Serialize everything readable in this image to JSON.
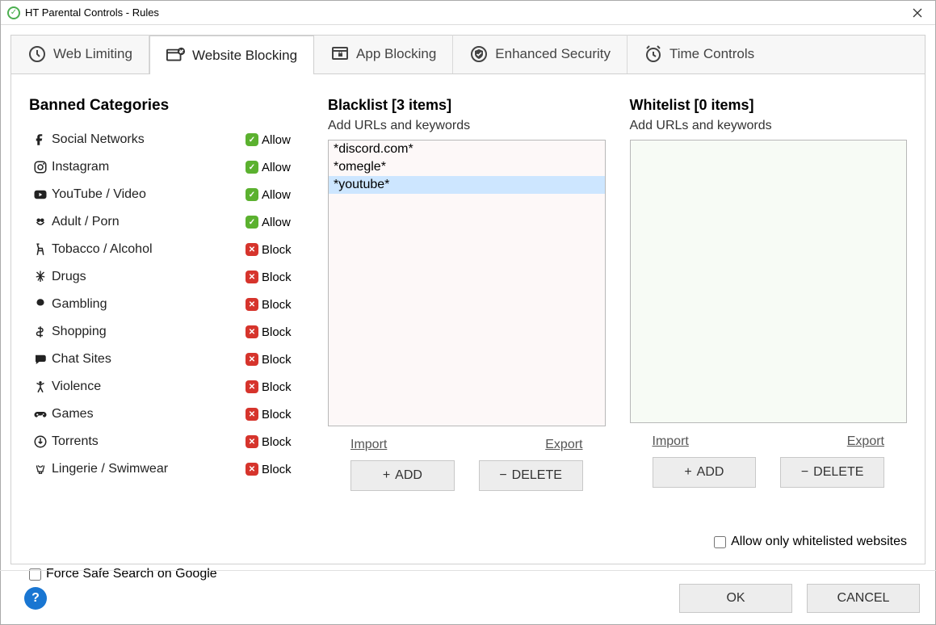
{
  "window": {
    "title": "HT Parental Controls - Rules"
  },
  "tabs": {
    "web_limiting": "Web Limiting",
    "website_blocking": "Website Blocking",
    "app_blocking": "App Blocking",
    "enhanced_security": "Enhanced Security",
    "time_controls": "Time Controls"
  },
  "categories": {
    "title": "Banned Categories",
    "allow_text": "Allow",
    "block_text": "Block",
    "items": [
      {
        "label": "Social Networks",
        "status": "allow"
      },
      {
        "label": "Instagram",
        "status": "allow"
      },
      {
        "label": "YouTube / Video",
        "status": "allow"
      },
      {
        "label": "Adult / Porn",
        "status": "allow"
      },
      {
        "label": "Tobacco / Alcohol",
        "status": "block"
      },
      {
        "label": "Drugs",
        "status": "block"
      },
      {
        "label": "Gambling",
        "status": "block"
      },
      {
        "label": "Shopping",
        "status": "block"
      },
      {
        "label": "Chat Sites",
        "status": "block"
      },
      {
        "label": "Violence",
        "status": "block"
      },
      {
        "label": "Games",
        "status": "block"
      },
      {
        "label": "Torrents",
        "status": "block"
      },
      {
        "label": "Lingerie / Swimwear",
        "status": "block"
      }
    ]
  },
  "blacklist": {
    "title": "Blacklist [3 items]",
    "desc": "Add URLs and keywords",
    "items": [
      "*discord.com*",
      "*omegle*",
      "*youtube*"
    ],
    "selected_index": 2,
    "import": "Import",
    "export": "Export",
    "add": "ADD",
    "delete": "DELETE"
  },
  "whitelist": {
    "title": "Whitelist [0 items]",
    "desc": "Add URLs and keywords",
    "items": [],
    "import": "Import",
    "export": "Export",
    "add": "ADD",
    "delete": "DELETE"
  },
  "checkboxes": {
    "safe_search": "Force Safe Search on Google",
    "only_whitelist": "Allow only whitelisted websites"
  },
  "footer": {
    "ok": "OK",
    "cancel": "CANCEL"
  }
}
